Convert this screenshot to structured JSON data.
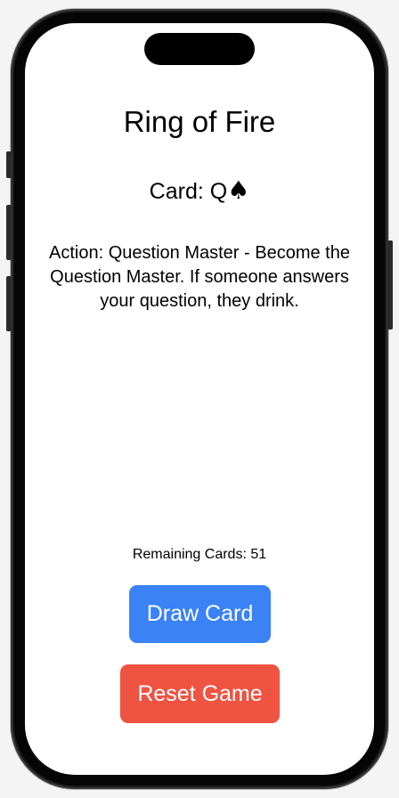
{
  "app": {
    "title": "Ring of Fire"
  },
  "card": {
    "label": "Card: Q",
    "suit": "♠"
  },
  "action": {
    "text": "Action: Question Master - Become the Question Master. If someone answers your question, they drink."
  },
  "status": {
    "remaining_text": "Remaining Cards: 51"
  },
  "buttons": {
    "draw_label": "Draw Card",
    "reset_label": "Reset Game"
  },
  "colors": {
    "draw_button": "#3a82f6",
    "reset_button": "#ef5341",
    "background": "#ffffff"
  },
  "icons": {
    "suit": "spade-icon"
  }
}
